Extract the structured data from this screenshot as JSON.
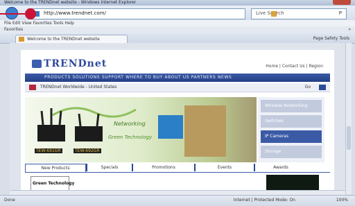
{
  "window": {
    "title": "Welcome to the TRENDnet website - Windows Internet Explorer"
  },
  "address_bar": {
    "url": "http://www.trendnet.com/",
    "search_label": "Live Search",
    "search_go": "P"
  },
  "menu": {
    "label": "File  Edit  View  Favorites  Tools  Help"
  },
  "favorites": {
    "label": "Favorites",
    "right": "»"
  },
  "tab": {
    "label": "Welcome to the TRENDnet website"
  },
  "command_bar": {
    "label": "Page  Safety  Tools"
  },
  "site": {
    "logo": "TRENDnet",
    "top_right": "Home | Contact Us | Region",
    "nav_label": "PRODUCTS   SOLUTIONS   SUPPORT   WHERE TO BUY   ABOUT US   PARTNERS   NEWS",
    "subnav_left": "TRENDnet Worldwide - United States",
    "subnav_right": "Go",
    "banner": {
      "headline": "Networking",
      "slogan": "Green Technology",
      "model_a": "TEW-691GR",
      "model_b": "TEW-692GR"
    },
    "sidebar": [
      "Wireless Networking",
      "Switches",
      "IP Cameras",
      "Storage"
    ],
    "page_tabs": [
      "New Products",
      "Specials",
      "Promotions",
      "Events",
      "Awards"
    ],
    "thumb_label": "Green Technology"
  },
  "status": {
    "text": "Done",
    "zone": "Internet | Protected Mode: On",
    "zoom": "100%"
  },
  "colors": {
    "accent": "#3b5aa6",
    "marker": "#cc1236"
  }
}
